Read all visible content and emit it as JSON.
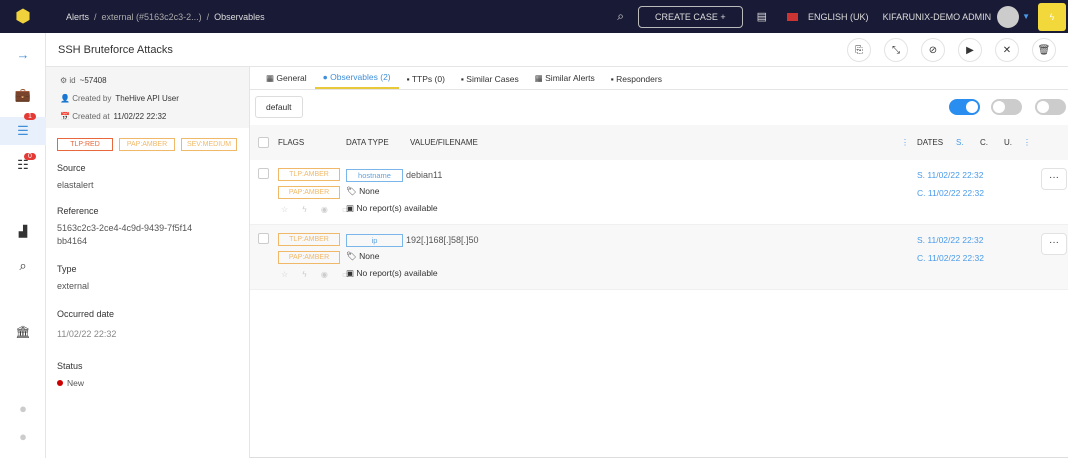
{
  "topbar": {
    "breadcrumb": [
      "Alerts",
      "external (#5163c2c3-2...)",
      "Observables"
    ],
    "create_case": "CREATE CASE",
    "language": "ENGLISH (UK)",
    "user": "KIFARUNIX-DEMO ADMIN"
  },
  "nav": {
    "badge_alerts": "1",
    "badge_tasks": "0"
  },
  "header": {
    "title": "SSH Bruteforce Attacks"
  },
  "meta": {
    "id_label": "id",
    "id": "~57408",
    "created_by_label": "Created by",
    "created_by": "TheHive API User",
    "created_at_label": "Created at",
    "created_at": "11/02/22 22:32"
  },
  "details": {
    "tags": [
      "TLP:RED",
      "PAP:AMBER",
      "SEV:MEDIUM"
    ],
    "source_label": "Source",
    "source": "elastalert",
    "reference_label": "Reference",
    "reference": "5163c2c3-2ce4-4c9d-9439-7f5f14bb4164",
    "type_label": "Type",
    "type": "external",
    "occurred_label": "Occurred date",
    "occurred": "11/02/22 22:32",
    "status_label": "Status",
    "status": "New"
  },
  "tabs": [
    "General",
    "Observables (2)",
    "TTPs (0)",
    "Similar Cases",
    "Similar Alerts",
    "Responders"
  ],
  "toolbar": {
    "preset": "default"
  },
  "table": {
    "headers": {
      "flags": "FLAGS",
      "data_type": "DATA TYPE",
      "value": "VALUE/FILENAME",
      "dates": "DATES",
      "s": "S.",
      "c": "C.",
      "u": "U."
    },
    "rows": [
      {
        "tlp": "TLP:AMBER",
        "pap": "PAP:AMBER",
        "type": "hostname",
        "value": "debian11",
        "tags": "None",
        "reports": "No report(s) available",
        "s_date": "S. 11/02/22 22:32",
        "c_date": "C. 11/02/22 22:32"
      },
      {
        "tlp": "TLP:AMBER",
        "pap": "PAP:AMBER",
        "type": "ip",
        "value": "192[.]168[.]58[.]50",
        "tags": "None",
        "reports": "No report(s) available",
        "s_date": "S. 11/02/22 22:32",
        "c_date": "C. 11/02/22 22:32"
      }
    ]
  }
}
